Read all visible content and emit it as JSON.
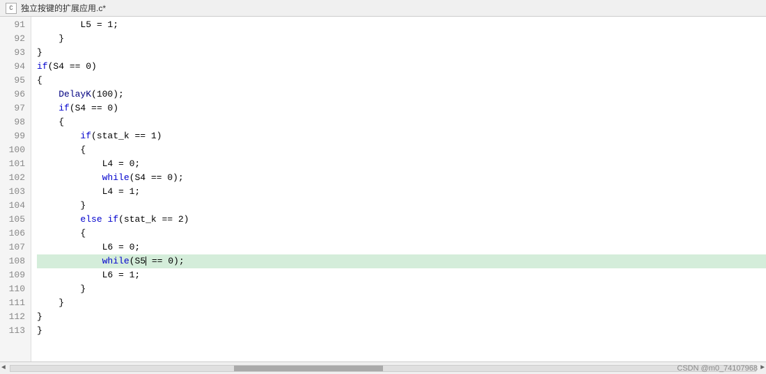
{
  "titlebar": {
    "icon_label": "C",
    "title": "独立按键的扩展应用.c*"
  },
  "lines": [
    {
      "num": "91",
      "code": "        L5 = 1;",
      "highlight": false
    },
    {
      "num": "92",
      "code": "    }",
      "highlight": false
    },
    {
      "num": "93",
      "code": "}",
      "highlight": false
    },
    {
      "num": "94",
      "code": "if(S4 == 0)",
      "highlight": false
    },
    {
      "num": "95",
      "code": "{",
      "highlight": false
    },
    {
      "num": "96",
      "code": "    DelayK(100);",
      "highlight": false
    },
    {
      "num": "97",
      "code": "    if(S4 == 0)",
      "highlight": false
    },
    {
      "num": "98",
      "code": "    {",
      "highlight": false
    },
    {
      "num": "99",
      "code": "        if(stat_k == 1)",
      "highlight": false
    },
    {
      "num": "100",
      "code": "        {",
      "highlight": false
    },
    {
      "num": "101",
      "code": "            L4 = 0;",
      "highlight": false
    },
    {
      "num": "102",
      "code": "            while(S4 == 0);",
      "highlight": false
    },
    {
      "num": "103",
      "code": "            L4 = 1;",
      "highlight": false
    },
    {
      "num": "104",
      "code": "        }",
      "highlight": false
    },
    {
      "num": "105",
      "code": "        else if(stat_k == 2)",
      "highlight": false
    },
    {
      "num": "106",
      "code": "        {",
      "highlight": false
    },
    {
      "num": "107",
      "code": "            L6 = 0;",
      "highlight": false
    },
    {
      "num": "108",
      "code": "            while(S5| == 0);",
      "highlight": true
    },
    {
      "num": "109",
      "code": "            L6 = 1;",
      "highlight": false
    },
    {
      "num": "110",
      "code": "        }",
      "highlight": false
    },
    {
      "num": "111",
      "code": "    }",
      "highlight": false
    },
    {
      "num": "112",
      "code": "}",
      "highlight": false
    },
    {
      "num": "113",
      "code": "}",
      "highlight": false
    }
  ],
  "watermark": "CSDN @m0_74107968",
  "scrollbar": {
    "left_btn": "◄",
    "right_btn": "►"
  }
}
